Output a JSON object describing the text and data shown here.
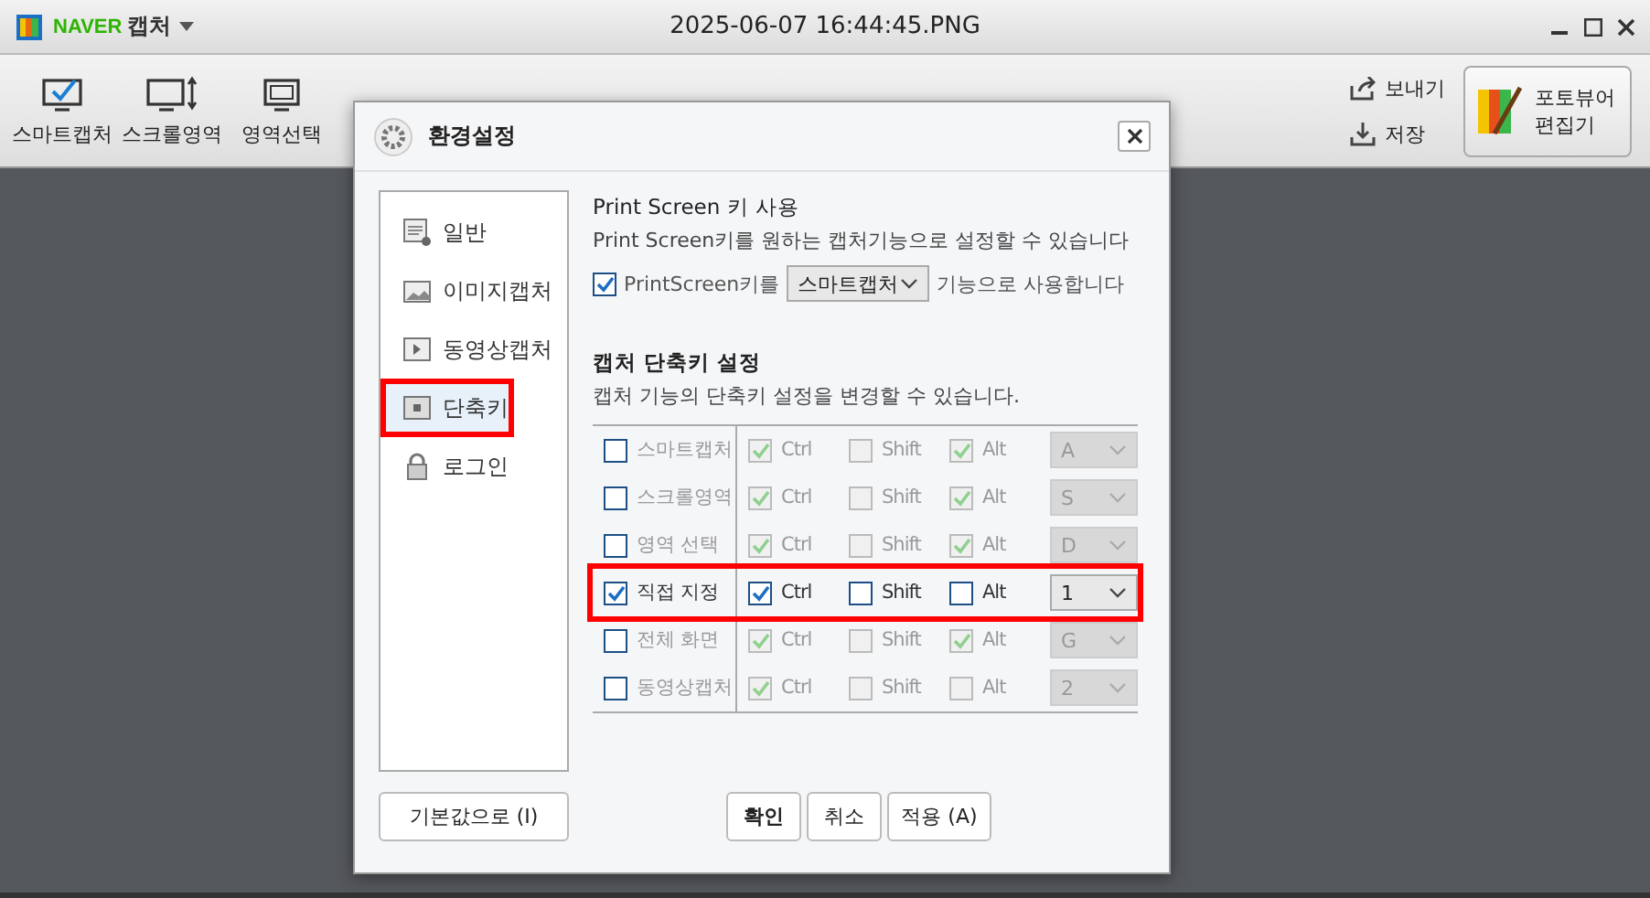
{
  "app": {
    "brand": "NAVER",
    "name": "캡처",
    "file_title": "2025-06-07 16:44:45.PNG"
  },
  "toolbar": {
    "tools": [
      {
        "label": "스마트캡처",
        "kind": "smart"
      },
      {
        "label": "스크롤영역",
        "kind": "scroll"
      },
      {
        "label": "영역선택",
        "kind": "region"
      }
    ],
    "actions": [
      "보내기",
      "저장"
    ],
    "editor_button": [
      "포토뷰어",
      "편집기"
    ]
  },
  "dialog": {
    "title": "환경설정",
    "sidebar": [
      {
        "label": "일반",
        "kind": "general",
        "selected": false,
        "highlighted": false
      },
      {
        "label": "이미지캡처",
        "kind": "image",
        "selected": false,
        "highlighted": false
      },
      {
        "label": "동영상캡처",
        "kind": "video",
        "selected": false,
        "highlighted": false
      },
      {
        "label": "단축키",
        "kind": "key",
        "selected": true,
        "highlighted": true
      },
      {
        "label": "로그인",
        "kind": "lock",
        "selected": false,
        "highlighted": false
      }
    ],
    "print_screen": {
      "heading": "Print Screen 키 사용",
      "description": "Print Screen키를 원하는 캡처기능으로 설정할 수 있습니다",
      "checked": true,
      "label": "PrintScreen키를",
      "value": "스마트캡처",
      "suffix": "기능으로 사용합니다"
    },
    "shortcuts": {
      "heading": "캡처 단축키 설정",
      "description": "캡처 기능의 단축키 설정을 변경할 수 있습니다.",
      "rows": [
        {
          "name": "스마트캡처",
          "checked": false,
          "highlighted": false,
          "key": "A",
          "modifiers": [
            {
              "label": "Ctrl",
              "checked": true
            },
            {
              "label": "Shift",
              "checked": false
            },
            {
              "label": "Alt",
              "checked": true
            }
          ]
        },
        {
          "name": "스크롤영역",
          "checked": false,
          "highlighted": false,
          "key": "S",
          "modifiers": [
            {
              "label": "Ctrl",
              "checked": true
            },
            {
              "label": "Shift",
              "checked": false
            },
            {
              "label": "Alt",
              "checked": true
            }
          ]
        },
        {
          "name": "영역 선택",
          "checked": false,
          "highlighted": false,
          "key": "D",
          "modifiers": [
            {
              "label": "Ctrl",
              "checked": true
            },
            {
              "label": "Shift",
              "checked": false
            },
            {
              "label": "Alt",
              "checked": true
            }
          ]
        },
        {
          "name": "직접 지정",
          "checked": true,
          "highlighted": true,
          "key": "1",
          "modifiers": [
            {
              "label": "Ctrl",
              "checked": true
            },
            {
              "label": "Shift",
              "checked": false
            },
            {
              "label": "Alt",
              "checked": false
            }
          ]
        },
        {
          "name": "전체 화면",
          "checked": false,
          "highlighted": false,
          "key": "G",
          "modifiers": [
            {
              "label": "Ctrl",
              "checked": true
            },
            {
              "label": "Shift",
              "checked": false
            },
            {
              "label": "Alt",
              "checked": true
            }
          ]
        },
        {
          "name": "동영상캡처",
          "checked": false,
          "highlighted": false,
          "key": "2",
          "modifiers": [
            {
              "label": "Ctrl",
              "checked": true
            },
            {
              "label": "Shift",
              "checked": false
            },
            {
              "label": "Alt",
              "checked": false
            }
          ]
        }
      ]
    },
    "buttons": {
      "reset": "기본값으로 (I)",
      "ok": "확인",
      "cancel": "취소",
      "apply": "적용 (A)"
    }
  }
}
